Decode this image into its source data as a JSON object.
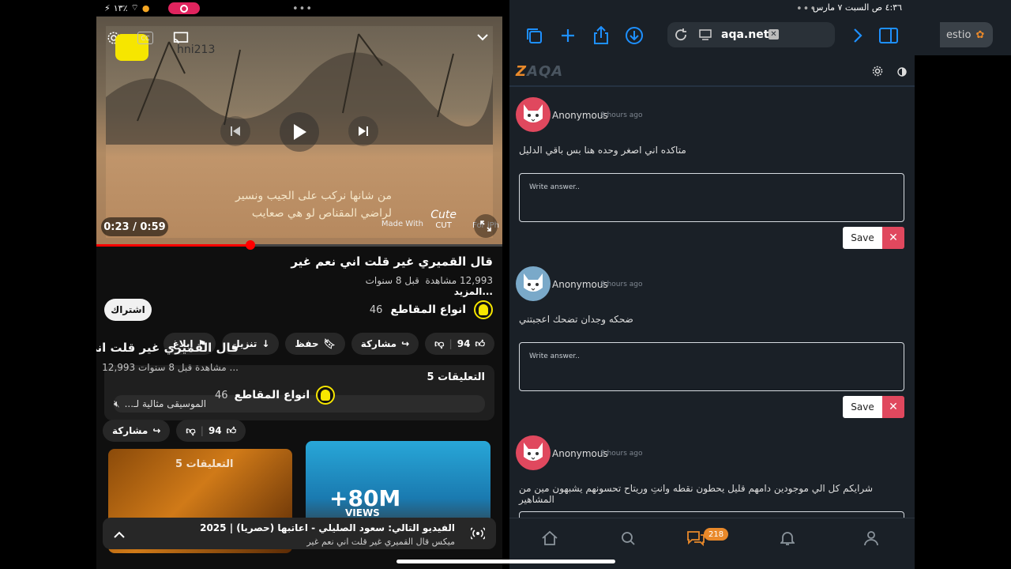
{
  "left_status": {
    "battery": "١٣٪"
  },
  "video": {
    "time": "0:23 / 0:59",
    "caption_line1": "من شانها نركب على الجيب ونسير",
    "caption_line2": "لراضي المقناص لو هي صعايب",
    "made_with": "Made With",
    "cut_logo": "Cute",
    "cut_sub": "CUT",
    "for_iphone": "For iPh",
    "watermark": "hni213",
    "progress_fraction": 0.38
  },
  "info": {
    "title": "قال القميري غير قلت اني نعم غير",
    "views": "12,993 مشاهدة",
    "age": "قبل 8 سنوات",
    "more": "...المزيد",
    "subscribe": "اشتراك",
    "channel_name": "انواع المقاطع",
    "channel_subs": "46"
  },
  "actions": {
    "likes": "94",
    "share": "مشاركة",
    "save": "حفظ",
    "download": "تنزيل",
    "report": "إبلاغ"
  },
  "ghost": {
    "title": "قال القميري غير قلت اني نعم غير",
    "meta": "12,993 مشاهدة  قبل 8 سنوات ...",
    "channel_name": "انواع المقاطع",
    "channel_subs": "46",
    "likes": "94",
    "share": "مشاركة"
  },
  "comments_card": {
    "header": "التعليقات 5",
    "preview": "الموسيقى مثالية لـ..."
  },
  "thumbs": {
    "t1_header": "التعليقات 5",
    "t2_big": "+80M",
    "t2_views": "VIEWS"
  },
  "miniplayer": {
    "line1": "الفيديو التالي: سعود الصليلي - اعاتبها (حصريا) | 2025",
    "line2": "ميكس قال القميري غير قلت اني نعم غير"
  },
  "right_status": {
    "datetime": "٤:٣٦ ص   السبت ٧ مارس"
  },
  "browser": {
    "url": "aqa.net",
    "tab2": "estio"
  },
  "site": {
    "logo_z": "Z",
    "logo_rest": "AQA"
  },
  "comments": [
    {
      "name": "Anonymous",
      "time": "8 hours ago",
      "text": "متاكده اني اصغر وحده هنا بس باقي الدليل",
      "placeholder": "Write answer..",
      "save": "Save",
      "avatar_color": "#e0485e"
    },
    {
      "name": "Anonymous",
      "time": "8 hours ago",
      "text": "ضحكه وجدان تضحك اعجبتني",
      "placeholder": "Write answer..",
      "save": "Save",
      "avatar_color": "#7aa9c9"
    },
    {
      "name": "Anonymous",
      "time": "8 hours ago",
      "text": "شرايكم كل الي موجودين دامهم قليل يحطون نقطه وانتِ وريتاح تحسونهم يشبهون مين من المشاهير",
      "placeholder": "Write answer..",
      "save": "Save",
      "avatar_color": "#e0485e"
    }
  ],
  "tabbar": {
    "badge": "218"
  },
  "colors": {
    "accent_blue": "#1e90ff",
    "youtube_red": "#ff0000",
    "zaqa_orange": "#e9892a",
    "danger": "#e0485e"
  }
}
